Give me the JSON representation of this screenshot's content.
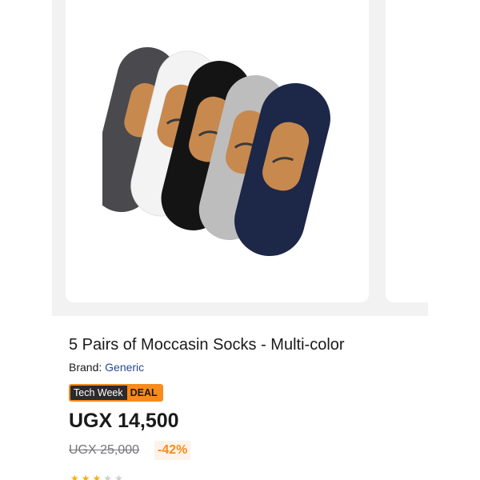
{
  "product": {
    "title": "5 Pairs of Moccasin Socks - Multi-color",
    "brand_label": "Brand:",
    "brand_name": "Generic",
    "badge": {
      "left": "Tech Week",
      "right": "DEAL"
    },
    "price": "UGX 14,500",
    "old_price": "UGX 25,000",
    "discount": "-42%",
    "rating": {
      "filled": 3,
      "total": 5
    }
  },
  "gallery": {
    "image_icon": "socks-product-image",
    "sock_colors": [
      "#4a4a4e",
      "#f3f3f3",
      "#141414",
      "#bdbdbd",
      "#1d2747"
    ],
    "label_color": "#c8894f"
  },
  "colors": {
    "accent": "#f68b1e",
    "link": "#264996",
    "text": "#1a1a1a",
    "muted": "#75757a"
  }
}
